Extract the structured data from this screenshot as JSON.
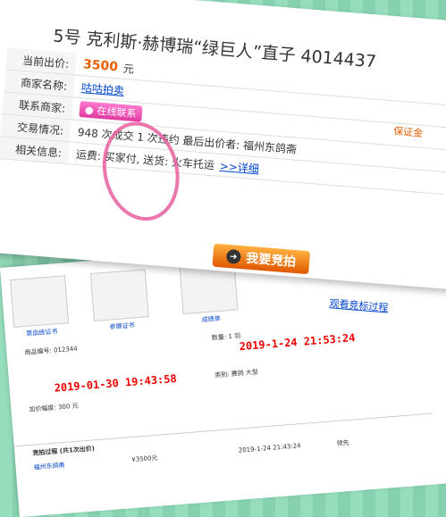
{
  "lot": {
    "title": "5号 克利斯·赫博瑞“绿巨人”直子 4014437",
    "deposit_label": "保证金"
  },
  "fields": {
    "price_label": "当前出价:",
    "price_value": "3500",
    "price_unit": "元",
    "merchant_label": "商家名称:",
    "merchant_value": "咕咕拍卖",
    "contact_label": "联系商家:",
    "contact_button": "在线联系",
    "trade_label": "交易情况:",
    "trade_value": "948 次成交  1 次违约  最后出价者: 福州东鸽斋",
    "related_label": "相关信息:",
    "related_value": "运费: 买家付, 送货: 火车托运",
    "detail_link": ">>详细"
  },
  "actions": {
    "bid_button": "我要竞拍",
    "history_link": "观看竞标过程"
  },
  "lower": {
    "thumb_captions": [
      "票血统证书",
      "参展证书",
      "成绩单"
    ],
    "qty_label": "数量: 1 羽",
    "end_time": "2019-1-24  21:53:24",
    "start_time": "2019-01-30 19:43:58",
    "lot_no": "商品编号: 012344",
    "add_price": "加价幅度: 300 元",
    "category": "类别: 赛鸽 大型",
    "history_title": "竞拍过程 (共1次出价)",
    "history_row": [
      "福州东鸽斋",
      "¥3500元",
      "2019-1-24 21:43:24",
      "领先"
    ]
  }
}
